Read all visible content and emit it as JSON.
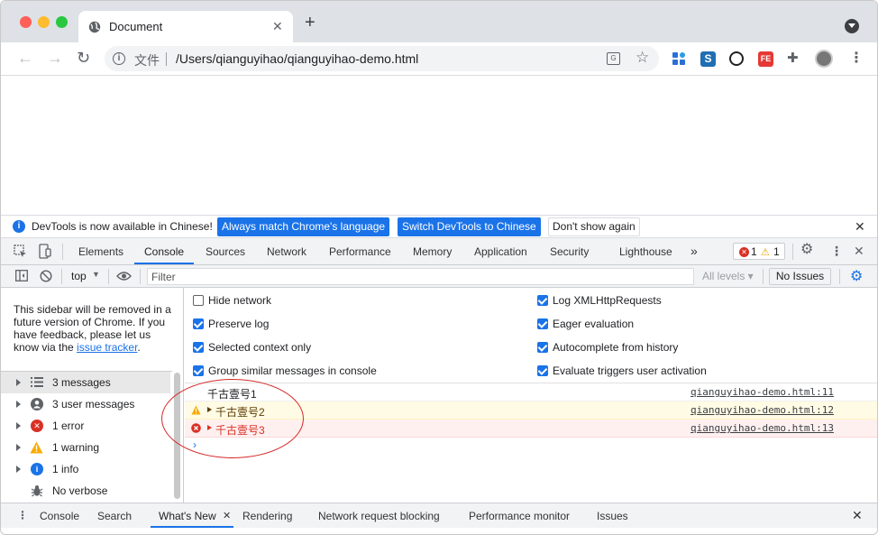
{
  "browser": {
    "tab_title": "Document",
    "new_tab": "+",
    "omnibox": {
      "scheme_label": "文件",
      "url": "/Users/qianguyihao/qianguyihao-demo.html"
    },
    "extensions": [
      "extension-blue-icon",
      "extension-s-icon",
      "extension-hexagon-icon",
      "extension-fe-icon",
      "puzzle-icon",
      "avatar"
    ]
  },
  "infobar": {
    "message": "DevTools is now available in Chinese!",
    "btn_match": "Always match Chrome's language",
    "btn_switch": "Switch DevTools to Chinese",
    "btn_dismiss": "Don't show again"
  },
  "devtools": {
    "tabs": [
      "Elements",
      "Console",
      "Sources",
      "Network",
      "Performance",
      "Memory",
      "Application",
      "Security",
      "Lighthouse"
    ],
    "active_tab": "Console",
    "more": "»",
    "error_count": "1",
    "warning_count": "1"
  },
  "console_toolbar": {
    "context": "top",
    "filter_placeholder": "Filter",
    "levels": "All levels ▾",
    "issues": "No Issues"
  },
  "sidebar": {
    "note_prefix": "This sidebar will be removed in a future version of Chrome. If you have feedback, please let us know via the ",
    "note_link": "issue tracker",
    "note_suffix": ".",
    "items": [
      {
        "label": "3 messages",
        "icon": "list-icon"
      },
      {
        "label": "3 user messages",
        "icon": "user-icon"
      },
      {
        "label": "1 error",
        "icon": "error-icon"
      },
      {
        "label": "1 warning",
        "icon": "warning-icon"
      },
      {
        "label": "1 info",
        "icon": "info-icon"
      },
      {
        "label": "No verbose",
        "icon": "bug-icon"
      }
    ]
  },
  "settings": {
    "left": [
      {
        "label": "Hide network",
        "checked": false
      },
      {
        "label": "Preserve log",
        "checked": true
      },
      {
        "label": "Selected context only",
        "checked": true
      },
      {
        "label": "Group similar messages in console",
        "checked": true
      }
    ],
    "right": [
      {
        "label": "Log XMLHttpRequests",
        "checked": true
      },
      {
        "label": "Eager evaluation",
        "checked": true
      },
      {
        "label": "Autocomplete from history",
        "checked": true
      },
      {
        "label": "Evaluate triggers user activation",
        "checked": true
      }
    ]
  },
  "messages": [
    {
      "text": "千古壹号1",
      "source": "qianguyihao-demo.html:11",
      "level": "log"
    },
    {
      "text": "千古壹号2",
      "source": "qianguyihao-demo.html:12",
      "level": "warning"
    },
    {
      "text": "千古壹号3",
      "source": "qianguyihao-demo.html:13",
      "level": "error"
    }
  ],
  "prompt": "›",
  "drawer": {
    "tabs": [
      "Console",
      "Search",
      "What's New",
      "Rendering",
      "Network request blocking",
      "Performance monitor",
      "Issues"
    ],
    "active_tab": "What's New"
  },
  "colors": {
    "accent": "#1a73e8",
    "error": "#d93025",
    "warning": "#e8a600",
    "annotation_circle": "#d62a2a"
  }
}
